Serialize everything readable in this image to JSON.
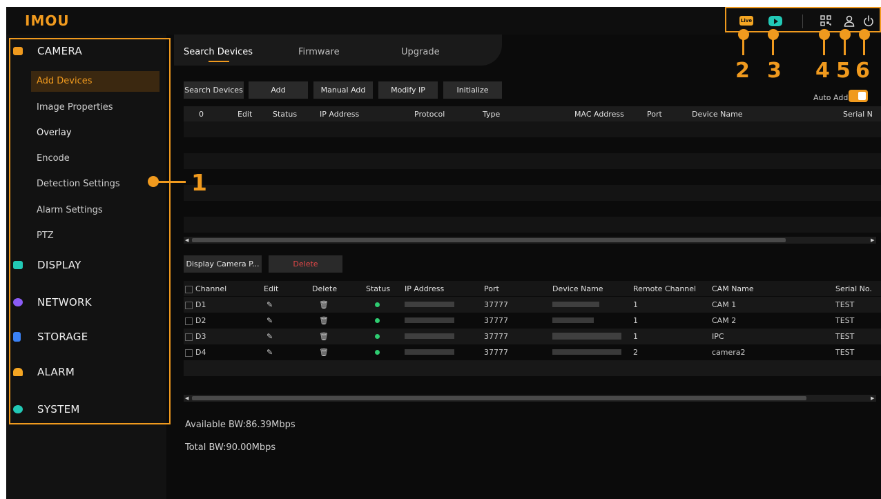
{
  "brand": {
    "logo": "IMOU"
  },
  "topbar": {
    "live_badge": "Live",
    "icons": [
      "live-icon",
      "playback-icon",
      "qr-icon",
      "user-icon",
      "power-icon"
    ]
  },
  "sidebar": {
    "categories": [
      {
        "label": "CAMERA",
        "icon": "camera-icon",
        "color": "#f09a1e"
      },
      {
        "label": "DISPLAY",
        "icon": "display-icon",
        "color": "#22c9b6"
      },
      {
        "label": "NETWORK",
        "icon": "network-icon",
        "color": "#8b5cf6"
      },
      {
        "label": "STORAGE",
        "icon": "storage-icon",
        "color": "#3b82f6"
      },
      {
        "label": "ALARM",
        "icon": "alarm-icon",
        "color": "#f5a623"
      },
      {
        "label": "SYSTEM",
        "icon": "system-icon",
        "color": "#22c9b6"
      }
    ],
    "camera_items": [
      "Add Devices",
      "Image Properties",
      "Overlay",
      "Encode",
      "Detection Settings",
      "Alarm Settings",
      "PTZ"
    ],
    "active_item": "Add Devices"
  },
  "tabs": [
    "Search Devices",
    "Firmware",
    "Upgrade"
  ],
  "toolbar": {
    "search_devices": "Search Devices",
    "add": "Add",
    "manual_add": "Manual Add",
    "modify_ip": "Modify IP",
    "initialize": "Initialize",
    "auto_add_label": "Auto Add",
    "auto_add_on": true
  },
  "search_table": {
    "headers": [
      "0",
      "Edit",
      "Status",
      "IP Address",
      "Protocol",
      "Type",
      "MAC Address",
      "Port",
      "Device Name",
      "Serial N"
    ]
  },
  "added_toolbar": {
    "display_camera": "Display Camera P...",
    "delete": "Delete"
  },
  "added_table": {
    "headers": [
      "Channel",
      "Edit",
      "Delete",
      "Status",
      "IP Address",
      "Port",
      "Device Name",
      "Remote Channel",
      "CAM Name",
      "Serial No."
    ],
    "rows": [
      {
        "channel": "D1",
        "port": "37777",
        "remote_channel": "1",
        "cam_name": "CAM 1",
        "serial": "TEST"
      },
      {
        "channel": "D2",
        "port": "37777",
        "remote_channel": "1",
        "cam_name": "CAM 2",
        "serial": "TEST"
      },
      {
        "channel": "D3",
        "port": "37777",
        "remote_channel": "1",
        "cam_name": "IPC",
        "serial": "TEST"
      },
      {
        "channel": "D4",
        "port": "37777",
        "remote_channel": "2",
        "cam_name": "camera2",
        "serial": "TEST"
      }
    ]
  },
  "bandwidth": {
    "available": "Available BW:86.39Mbps",
    "total": "Total BW:90.00Mbps"
  },
  "annotations": [
    "1",
    "2",
    "3",
    "4",
    "5",
    "6"
  ]
}
